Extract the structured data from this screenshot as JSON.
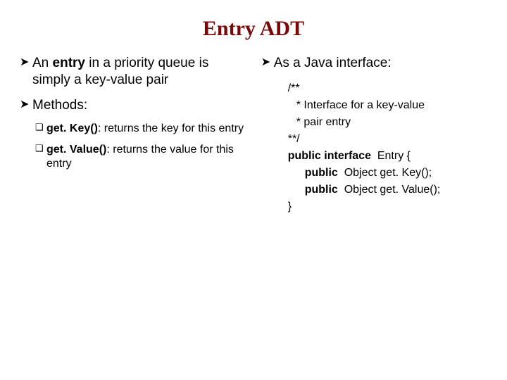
{
  "title": "Entry ADT",
  "left": {
    "intro_pre": "An ",
    "intro_bold": "entry",
    "intro_post": " in a priority queue is simply a key-value pair",
    "methods_label": "Methods:",
    "methods": [
      {
        "name": "get. Key()",
        "desc": ": returns the key for this entry"
      },
      {
        "name": "get. Value()",
        "desc": ": returns the value for this entry"
      }
    ]
  },
  "right": {
    "intro": "As a Java interface:",
    "code": {
      "l1": "/**",
      "l2": "* Interface for a key-value",
      "l3": "* pair entry",
      "l4": "**/",
      "l5a": "public interface",
      "l5b": "  Entry {",
      "l6a": "public",
      "l6b": "  Object get. Key();",
      "l7a": "public",
      "l7b": "  Object get. Value();",
      "l8": "}"
    }
  },
  "markers": {
    "arrow": "➤",
    "square": "❑"
  }
}
